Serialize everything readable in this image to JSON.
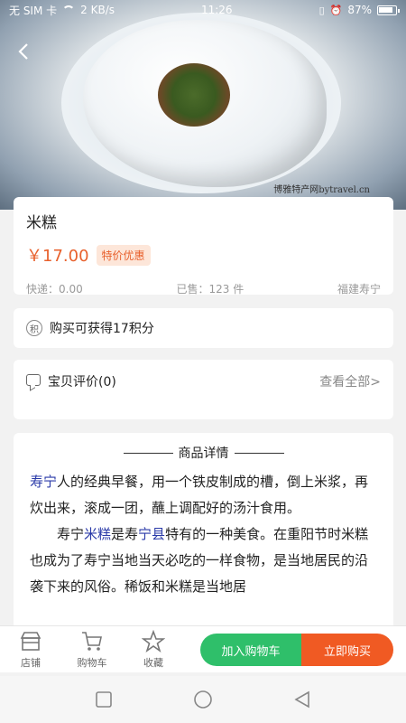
{
  "status_bar": {
    "carrier": "无 SIM 卡",
    "speed": "2 KB/s",
    "time": "11:26",
    "battery": "87%"
  },
  "hero": {
    "watermark": "博雅特产网bytravel.cn"
  },
  "product": {
    "title": "米糕",
    "price": "￥17.00",
    "promo_badge": "特价优惠",
    "shipping": "快递：0.00",
    "sold": "已售：123 件",
    "origin": "福建寿宁"
  },
  "points": {
    "icon_text": "积",
    "text": "购买可获得17积分"
  },
  "reviews": {
    "label": "宝贝评价(0)",
    "view_all": "查看全部>"
  },
  "detail": {
    "heading": "商品详情",
    "p1_link": "寿宁",
    "p1_text": "人的经典早餐，用一个铁皮制成的槽，倒上米浆，再炊出来，滚成一团，蘸上调配好的汤汁食用。",
    "p2_a": "寿宁",
    "p2_link1": "米糕",
    "p2_b": "是寿",
    "p2_link2": "宁县",
    "p2_c": "特有的一种美食。在重阳节时米糕也成为了寿宁当地当天必吃的一样食物，是当地居民的沿袭下来的风俗。稀饭和米糕是当地居"
  },
  "action_bar": {
    "store": "店铺",
    "cart": "购物车",
    "favorite": "收藏",
    "add_to_cart": "加入购物车",
    "buy_now": "立即购买"
  }
}
